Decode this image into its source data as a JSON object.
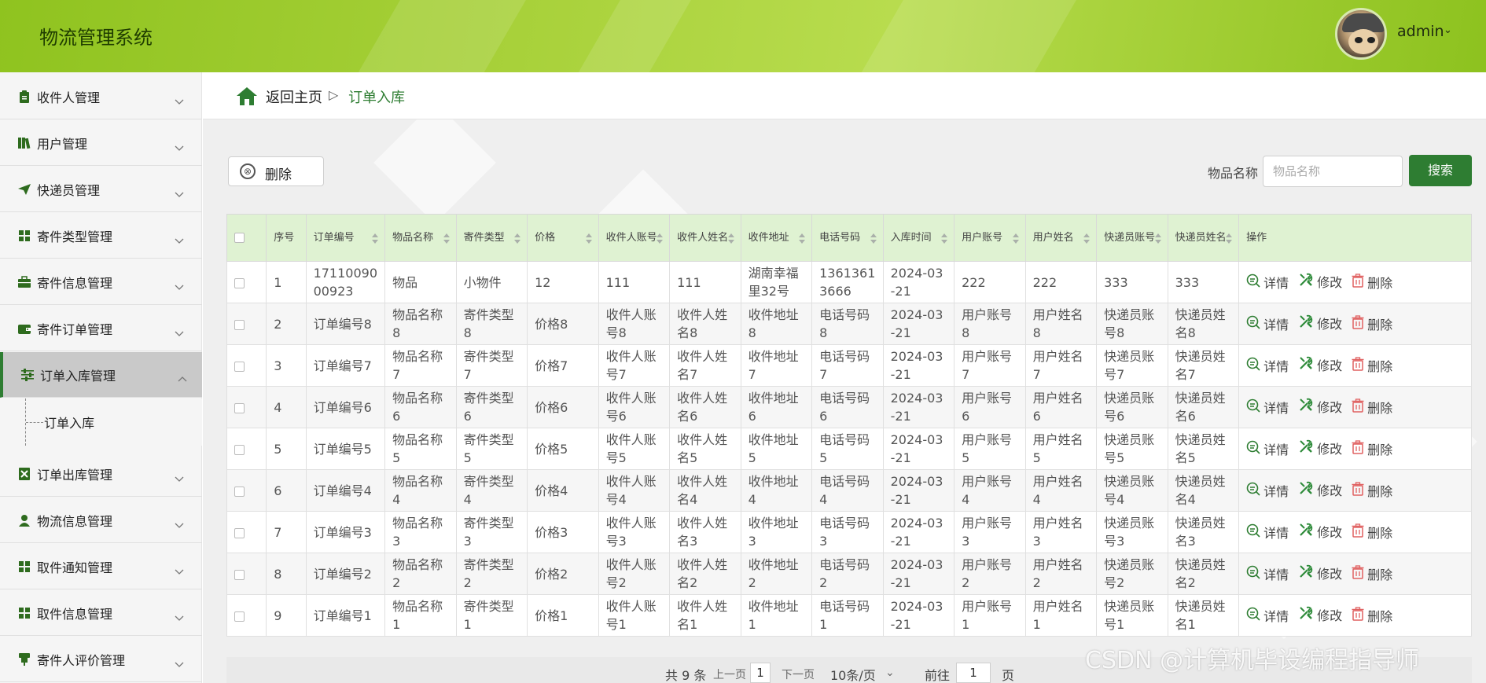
{
  "header": {
    "app_title": "物流管理系统",
    "user_name": "admin",
    "user_caret": "⌄"
  },
  "sidebar": {
    "items": [
      {
        "label": "收件人管理",
        "icon": "clipboard-icon"
      },
      {
        "label": "用户管理",
        "icon": "books-icon"
      },
      {
        "label": "快递员管理",
        "icon": "paper-plane-icon"
      },
      {
        "label": "寄件类型管理",
        "icon": "grid-icon"
      },
      {
        "label": "寄件信息管理",
        "icon": "briefcase-icon"
      },
      {
        "label": "寄件订单管理",
        "icon": "wallet-icon"
      },
      {
        "label": "订单入库管理",
        "icon": "sliders-icon"
      },
      {
        "label": "订单出库管理",
        "icon": "excel-icon"
      },
      {
        "label": "物流信息管理",
        "icon": "user-icon"
      },
      {
        "label": "取件通知管理",
        "icon": "grid-icon"
      },
      {
        "label": "取件信息管理",
        "icon": "grid-icon"
      },
      {
        "label": "寄件人评价管理",
        "icon": "stamp-icon"
      }
    ],
    "sub_item": "订单入库"
  },
  "breadcrumb": {
    "home": "返回主页",
    "sep": "▷",
    "current": "订单入库"
  },
  "toolbar": {
    "delete_label": "删除",
    "delete_icon": "⊗",
    "search_label": "物品名称",
    "search_placeholder": "物品名称",
    "search_button": "搜索"
  },
  "table": {
    "headers": [
      "序号",
      "订单编号",
      "物品名称",
      "寄件类型",
      "价格",
      "收件人账号",
      "收件人姓名",
      "收件地址",
      "电话号码",
      "入库时间",
      "用户账号",
      "用户姓名",
      "快递员账号",
      "快递员姓名",
      "操作"
    ],
    "rows": [
      [
        "1",
        "1711009000923",
        "物品",
        "小物件",
        "12",
        "111",
        "111",
        "湖南幸福里32号",
        "13613613666",
        "2024-03-21",
        "222",
        "222",
        "333",
        "333"
      ],
      [
        "2",
        "订单编号8",
        "物品名称8",
        "寄件类型8",
        "价格8",
        "收件人账号8",
        "收件人姓名8",
        "收件地址8",
        "电话号码8",
        "2024-03-21",
        "用户账号8",
        "用户姓名8",
        "快递员账号8",
        "快递员姓名8"
      ],
      [
        "3",
        "订单编号7",
        "物品名称7",
        "寄件类型7",
        "价格7",
        "收件人账号7",
        "收件人姓名7",
        "收件地址7",
        "电话号码7",
        "2024-03-21",
        "用户账号7",
        "用户姓名7",
        "快递员账号7",
        "快递员姓名7"
      ],
      [
        "4",
        "订单编号6",
        "物品名称6",
        "寄件类型6",
        "价格6",
        "收件人账号6",
        "收件人姓名6",
        "收件地址6",
        "电话号码6",
        "2024-03-21",
        "用户账号6",
        "用户姓名6",
        "快递员账号6",
        "快递员姓名6"
      ],
      [
        "5",
        "订单编号5",
        "物品名称5",
        "寄件类型5",
        "价格5",
        "收件人账号5",
        "收件人姓名5",
        "收件地址5",
        "电话号码5",
        "2024-03-21",
        "用户账号5",
        "用户姓名5",
        "快递员账号5",
        "快递员姓名5"
      ],
      [
        "6",
        "订单编号4",
        "物品名称4",
        "寄件类型4",
        "价格4",
        "收件人账号4",
        "收件人姓名4",
        "收件地址4",
        "电话号码4",
        "2024-03-21",
        "用户账号4",
        "用户姓名4",
        "快递员账号4",
        "快递员姓名4"
      ],
      [
        "7",
        "订单编号3",
        "物品名称3",
        "寄件类型3",
        "价格3",
        "收件人账号3",
        "收件人姓名3",
        "收件地址3",
        "电话号码3",
        "2024-03-21",
        "用户账号3",
        "用户姓名3",
        "快递员账号3",
        "快递员姓名3"
      ],
      [
        "8",
        "订单编号2",
        "物品名称2",
        "寄件类型2",
        "价格2",
        "收件人账号2",
        "收件人姓名2",
        "收件地址2",
        "电话号码2",
        "2024-03-21",
        "用户账号2",
        "用户姓名2",
        "快递员账号2",
        "快递员姓名2"
      ],
      [
        "9",
        "订单编号1",
        "物品名称1",
        "寄件类型1",
        "价格1",
        "收件人账号1",
        "收件人姓名1",
        "收件地址1",
        "电话号码1",
        "2024-03-21",
        "用户账号1",
        "用户姓名1",
        "快递员账号1",
        "快递员姓名1"
      ]
    ],
    "actions": {
      "detail": "详情",
      "edit": "修改",
      "delete": "删除"
    }
  },
  "pagination": {
    "total": "共 9 条",
    "prev": "上一页",
    "page": "1",
    "next": "下一页",
    "page_size": "10条/页",
    "page_size_caret": "⌄",
    "goto_prefix": "前往",
    "goto_value": "1",
    "goto_suffix": "页"
  },
  "watermark": "CSDN @计算机毕设编程指导师",
  "colors": {
    "primary": "#2e7d32",
    "header": "#9dcb2f",
    "table_header": "#dff2d2",
    "danger": "#e06060"
  }
}
